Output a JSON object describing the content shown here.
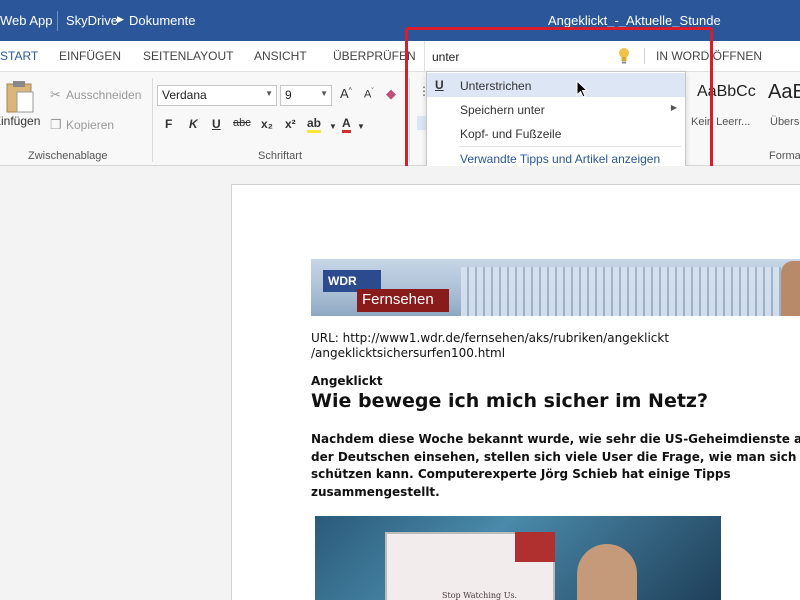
{
  "titlebar": {
    "app_name": "Web App",
    "breadcrumb": [
      "SkyDrive",
      "Dokumente"
    ],
    "document_title": "Angeklickt_-_Aktuelle_Stunde"
  },
  "ribbon_tabs": {
    "start": "START",
    "insert": "EINFÜGEN",
    "layout": "SEITENLAYOUT",
    "view": "ANSICHT",
    "review": "ÜBERPRÜFEN",
    "open_in_word": "IN WORD ÖFFNEN"
  },
  "tell_me": {
    "query": "unter",
    "icon": "lightbulb-icon"
  },
  "ribbon": {
    "clipboard": {
      "paste": "Einfügen",
      "cut": "Ausschneiden",
      "copy": "Kopieren",
      "label": "Zwischenablage"
    },
    "font": {
      "font_name": "Verdana",
      "font_size": "9",
      "label": "Schriftart",
      "buttons": [
        "F",
        "K",
        "U",
        "abc",
        "x₂",
        "x²"
      ]
    },
    "styles": {
      "sample1": "AaBbCc",
      "name1": "Kein Leerr...",
      "sample2": "AaB",
      "name2": "Übersc",
      "label": "Forma"
    }
  },
  "dropdown": {
    "items": [
      {
        "label": "Unterstrichen",
        "icon": "U"
      },
      {
        "label": "Speichern unter"
      },
      {
        "label": "Kopf- und Fußzeile"
      }
    ],
    "link": "Verwandte Tipps und Artikel anzeigen"
  },
  "document": {
    "banner_logo": "WDR",
    "banner_title": "Fernsehen",
    "url_line1": " URL: http://www1.wdr.de/fernsehen/aks/rubriken/angeklickt",
    "url_line2": "/angeklicktsichersurfen100.html",
    "kicker": "Angeklickt",
    "headline": "Wie bewege ich mich sicher im Netz?",
    "teaser_lines": [
      "Nachdem diese Woche bekannt wurde, wie sehr die US-Geheimdienste auc",
      "der Deutschen einsehen, stellen sich viele User die Frage, wie man sich an",
      "schützen kann. Computerexperte Jörg Schieb hat einige Tipps",
      " zusammengestellt."
    ],
    "photo_caption": "Stop Watching Us."
  },
  "colors": {
    "brand_blue": "#2b579a",
    "highlight": "#dce6f4",
    "annotation_red": "#d81e2a"
  }
}
